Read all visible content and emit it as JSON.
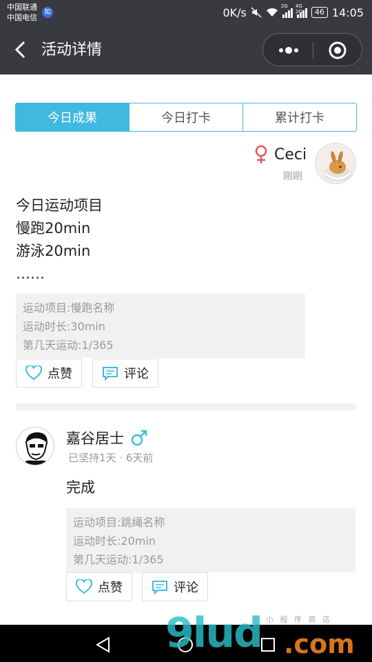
{
  "status_bar": {
    "carrier_1": "中国联通",
    "carrier_2": "中国电信",
    "carrier_badge": "知",
    "net_speed": "0K/s",
    "signal_1_label": "2G",
    "signal_2_label": "4G 2G",
    "battery": "46",
    "time": "14:05"
  },
  "header": {
    "title": "活动详情",
    "bg_color": "#393a3f"
  },
  "tabs": [
    {
      "label": "今日成果",
      "active": true
    },
    {
      "label": "今日打卡",
      "active": false
    },
    {
      "label": "累计打卡",
      "active": false
    }
  ],
  "accent_color": "#40b8e0",
  "posts": [
    {
      "user": "Ceci",
      "gender_icon": "female-icon",
      "time": "刚刚",
      "content": [
        "今日运动项目",
        "慢跑20min",
        "游泳20min",
        "……"
      ],
      "info": {
        "item": "运动项目:慢跑名称",
        "duration": "运动时长:30min",
        "day": "第几天运动:1/365"
      },
      "like_label": "点赞",
      "comment_label": "评论"
    },
    {
      "user": "嘉谷居士",
      "gender_icon": "male-icon",
      "streak": "已坚持1天",
      "dot": "·",
      "time": "6天前",
      "content": [
        "完成"
      ],
      "info": {
        "item": "运动项目:跳绳名称",
        "duration": "运动时长:20min",
        "day": "第几天运动:1/365"
      },
      "like_label": "点赞",
      "comment_label": "评论"
    }
  ],
  "watermark": {
    "main": "9lud",
    "suffix": ".com",
    "small": "小 程 序 商 店"
  }
}
